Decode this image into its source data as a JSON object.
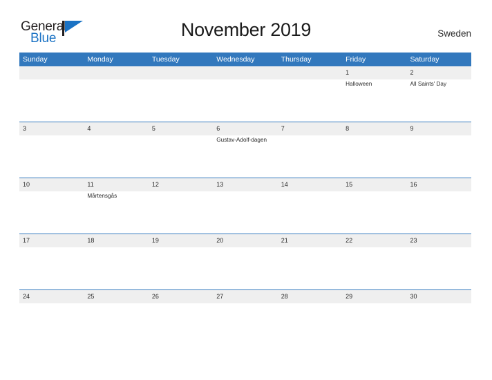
{
  "brand": {
    "name_top": "General",
    "name_bottom": "Blue",
    "flag_color": "#1a72c4",
    "text_color": "#231f20"
  },
  "header": {
    "title": "November 2019",
    "country": "Sweden"
  },
  "theme": {
    "header_blue": "#3278bd",
    "date_band": "#efefef",
    "divider": "#3278bd",
    "text": "#2a2a2a",
    "page_background": "#ffffff"
  },
  "calendar": {
    "month": "November",
    "year": "2019",
    "weekday_headers": [
      "Sunday",
      "Monday",
      "Tuesday",
      "Wednesday",
      "Thursday",
      "Friday",
      "Saturday"
    ],
    "weeks": [
      {
        "days": [
          {
            "num": "",
            "events": []
          },
          {
            "num": "",
            "events": []
          },
          {
            "num": "",
            "events": []
          },
          {
            "num": "",
            "events": []
          },
          {
            "num": "",
            "events": []
          },
          {
            "num": "1",
            "events": [
              "Halloween"
            ]
          },
          {
            "num": "2",
            "events": [
              "All Saints' Day"
            ]
          }
        ]
      },
      {
        "days": [
          {
            "num": "3",
            "events": []
          },
          {
            "num": "4",
            "events": []
          },
          {
            "num": "5",
            "events": []
          },
          {
            "num": "6",
            "events": [
              "Gustav-Adolf-dagen"
            ]
          },
          {
            "num": "7",
            "events": []
          },
          {
            "num": "8",
            "events": []
          },
          {
            "num": "9",
            "events": []
          }
        ]
      },
      {
        "days": [
          {
            "num": "10",
            "events": []
          },
          {
            "num": "11",
            "events": [
              "Mårtensgås"
            ]
          },
          {
            "num": "12",
            "events": []
          },
          {
            "num": "13",
            "events": []
          },
          {
            "num": "14",
            "events": []
          },
          {
            "num": "15",
            "events": []
          },
          {
            "num": "16",
            "events": []
          }
        ]
      },
      {
        "days": [
          {
            "num": "17",
            "events": []
          },
          {
            "num": "18",
            "events": []
          },
          {
            "num": "19",
            "events": []
          },
          {
            "num": "20",
            "events": []
          },
          {
            "num": "21",
            "events": []
          },
          {
            "num": "22",
            "events": []
          },
          {
            "num": "23",
            "events": []
          }
        ]
      },
      {
        "days": [
          {
            "num": "24",
            "events": []
          },
          {
            "num": "25",
            "events": []
          },
          {
            "num": "26",
            "events": []
          },
          {
            "num": "27",
            "events": []
          },
          {
            "num": "28",
            "events": []
          },
          {
            "num": "29",
            "events": []
          },
          {
            "num": "30",
            "events": []
          }
        ]
      }
    ]
  }
}
